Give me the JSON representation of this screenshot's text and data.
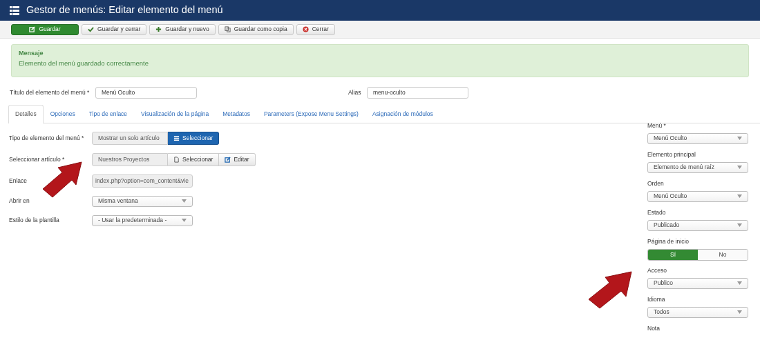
{
  "header": {
    "title": "Gestor de menús: Editar elemento del menú"
  },
  "toolbar": [
    {
      "label": "Guardar",
      "kind": "primary"
    },
    {
      "label": "Guardar y cerrar",
      "kind": "default"
    },
    {
      "label": "Guardar y nuevo",
      "kind": "default"
    },
    {
      "label": "Guardar como copia",
      "kind": "default"
    },
    {
      "label": "Cerrar",
      "kind": "default"
    }
  ],
  "message": {
    "heading": "Mensaje",
    "text": "Elemento del menú guardado correctamente"
  },
  "title_field": {
    "label": "Título del elemento del menú *",
    "value": "Menú Oculto"
  },
  "alias_field": {
    "label": "Alias",
    "value": "menu-oculto"
  },
  "tabs": [
    {
      "label": "Detalles",
      "selected": true
    },
    {
      "label": "Opciones",
      "selected": false
    },
    {
      "label": "Tipo de enlace",
      "selected": false
    },
    {
      "label": "Visualización de la página",
      "selected": false
    },
    {
      "label": "Metadatos",
      "selected": false
    },
    {
      "label": "Parameters (Expose Menu Settings)",
      "selected": false
    },
    {
      "label": "Asignación de módulos",
      "selected": false
    }
  ],
  "details": [
    {
      "kind": "picker",
      "label": "Tipo de elemento del menú *",
      "value": "Mostrar un solo artículo",
      "buttons": [
        {
          "label": "Seleccionar",
          "kind": "primary"
        }
      ]
    },
    {
      "kind": "picker",
      "label": "Seleccionar artículo *",
      "value": "Nuestros Proyectos",
      "buttons": [
        {
          "label": "Seleccionar",
          "kind": "default"
        },
        {
          "label": "Editar",
          "kind": "default"
        }
      ]
    },
    {
      "kind": "readonly",
      "label": "Enlace",
      "value": "index.php?option=com_content&vie"
    },
    {
      "kind": "select",
      "label": "Abrir en",
      "value": "Misma ventana"
    },
    {
      "kind": "select",
      "label": "Estilo de la plantilla",
      "value": "- Usar la predeterminada -"
    }
  ],
  "sidebar": [
    {
      "kind": "select",
      "label": "Menú *",
      "value": "Menú Oculto"
    },
    {
      "kind": "select",
      "label": "Elemento principal",
      "value": "Elemento de menú raíz"
    },
    {
      "kind": "select",
      "label": "Orden",
      "value": "Menú Oculto"
    },
    {
      "kind": "select",
      "label": "Estado",
      "value": "Publicado"
    },
    {
      "kind": "toggle",
      "label": "Página de inicio",
      "options": [
        {
          "label": "Sí",
          "selected": true
        },
        {
          "label": "No",
          "selected": false
        }
      ]
    },
    {
      "kind": "select",
      "label": "Acceso",
      "value": "Publico"
    },
    {
      "kind": "select",
      "label": "Idioma",
      "value": "Todos"
    },
    {
      "kind": "label",
      "label": "Nota"
    }
  ]
}
